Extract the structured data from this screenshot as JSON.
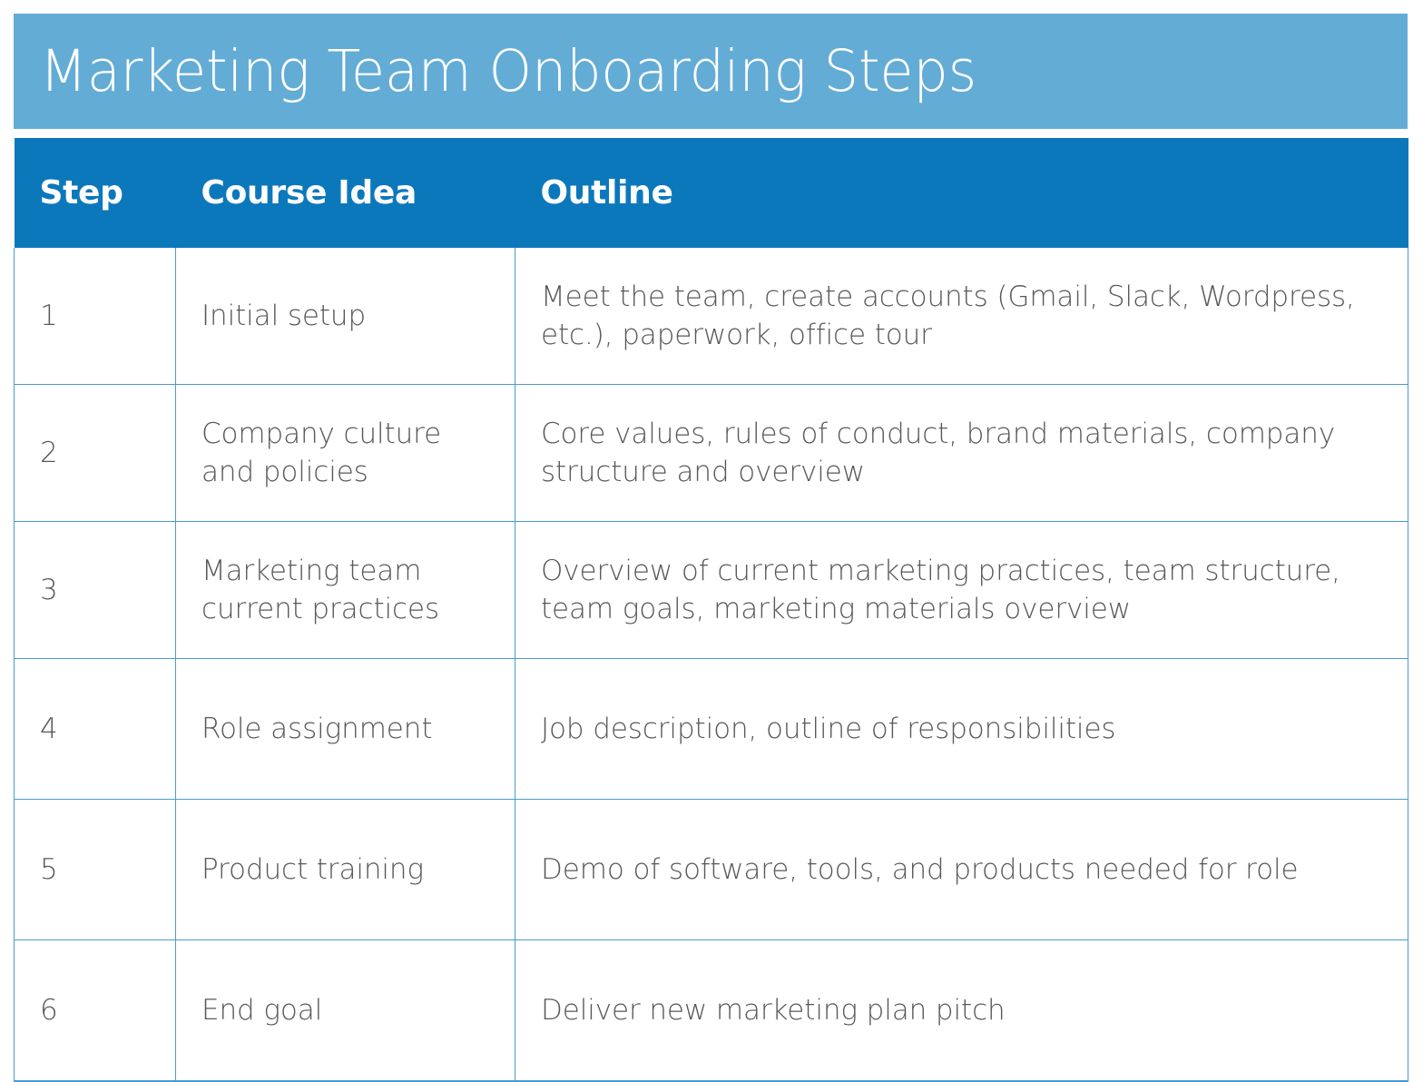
{
  "document": {
    "title": "Marketing Team Onboarding Steps"
  },
  "colors": {
    "title_banner": "#63ACD6",
    "header_row": "#0C78BC",
    "grid_line": "#4A9BCE",
    "body_text": "#58585A",
    "header_text": "#FFFFFF",
    "page_background": "#FFFFFF"
  },
  "table": {
    "columns": [
      {
        "key": "step",
        "label": "Step"
      },
      {
        "key": "course",
        "label": "Course Idea"
      },
      {
        "key": "outline",
        "label": "Outline"
      }
    ],
    "rows": [
      {
        "step": "1",
        "course": "Initial setup",
        "outline": "Meet the team, create accounts (Gmail, Slack, Wordpress, etc.), paperwork, office tour"
      },
      {
        "step": "2",
        "course": "Company culture and policies",
        "outline": "Core values, rules of conduct, brand materials, company structure and overview"
      },
      {
        "step": "3",
        "course": "Marketing team current practices",
        "outline": "Overview of current marketing practices, team structure, team goals, marketing materials overview"
      },
      {
        "step": "4",
        "course": "Role assignment",
        "outline": "Job description, outline of responsibilities"
      },
      {
        "step": "5",
        "course": "Product training",
        "outline": "Demo of software, tools, and products needed for role"
      },
      {
        "step": "6",
        "course": "End goal",
        "outline": "Deliver new marketing plan pitch"
      }
    ]
  }
}
